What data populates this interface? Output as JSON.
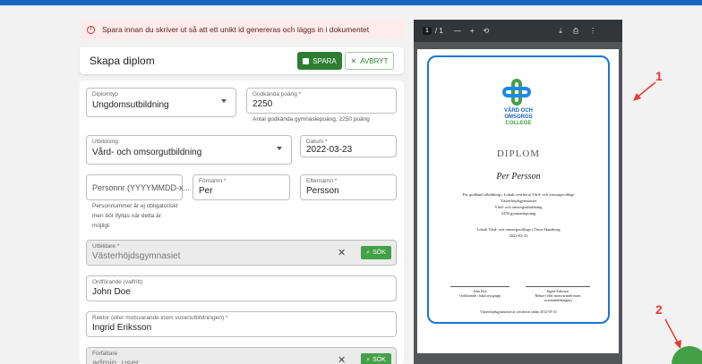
{
  "alert": {
    "text": "Spara innan du skriver ut så att ett unikt id genereras och läggs in i dokumentet"
  },
  "header": {
    "title": "Skapa diplom",
    "save_label": "SPARA",
    "cancel_label": "AVBRYT"
  },
  "form": {
    "diplomtyp": {
      "label": "Diplomtyp",
      "value": "Ungdomsutbildning"
    },
    "poang": {
      "label": "Godkända poäng *",
      "value": "2250",
      "helper": "Antal godkända gymnasiepoäng, 2250 poäng"
    },
    "utbildning": {
      "label": "Utbildning",
      "value": "Vård- och omsorgutbildning"
    },
    "datum": {
      "label": "Datum *",
      "value": "2022-03-23"
    },
    "personnr": {
      "placeholder": "Personnr (YYYYMMDD-x...",
      "helper": [
        "Personnummer är ej obligatoriskt",
        "men bör ifyllas när detta är",
        "möjligt."
      ]
    },
    "fornamn": {
      "label": "Förnamn *",
      "value": "Per"
    },
    "efternamn": {
      "label": "Efternamn *",
      "value": "Persson"
    },
    "utbildare": {
      "label": "Utbildare *",
      "value": "Västerhöjdsgymnasiet",
      "search_label": "SÖK"
    },
    "ordforande": {
      "label": "Ordförande (valfritt)",
      "value": "John Doe"
    },
    "rektor": {
      "label": "Rektor (eller motsvarande inom vuxenutbildningen) *",
      "value": "Ingrid Eriksson"
    },
    "forfattare": {
      "label": "Författare",
      "value": "admin_user",
      "search_label": "SÖK"
    }
  },
  "viewer": {
    "page_current": "1",
    "page_total": "/ 1",
    "logo_lines": [
      "VÅRD OCH",
      "OMSORGS",
      "COLLEGE"
    ],
    "diplom_title": "DIPLOM",
    "name": "Per Persson",
    "body_lines": [
      "För godkänd utbildning i Lokalt certifierat Vård- och omsorgscollege",
      "Västerhöjdsgymnasiet",
      "Vård- och omsorgsutbildning",
      "2250 gymnasiepoäng"
    ],
    "local_lines": [
      "Lokalt Vård- och omsorgscollege i Östra Skaraborg",
      "2022-03-23"
    ],
    "sign_left": [
      "John Doe",
      "Ordförande i lokal styrgrupp"
    ],
    "sign_right": [
      "Ingrid Eriksson",
      "Rektor (eller motsvarande inom",
      "vuxenutbildningen)"
    ],
    "footer": "Västerhöjdsgymnasiet är certifierat sedan 2012-05-31"
  },
  "annotations": {
    "one": "1",
    "two": "2"
  },
  "colors": {
    "primary": "#2e7d32",
    "accent": "#1565c0",
    "annotation": "#e53935"
  }
}
